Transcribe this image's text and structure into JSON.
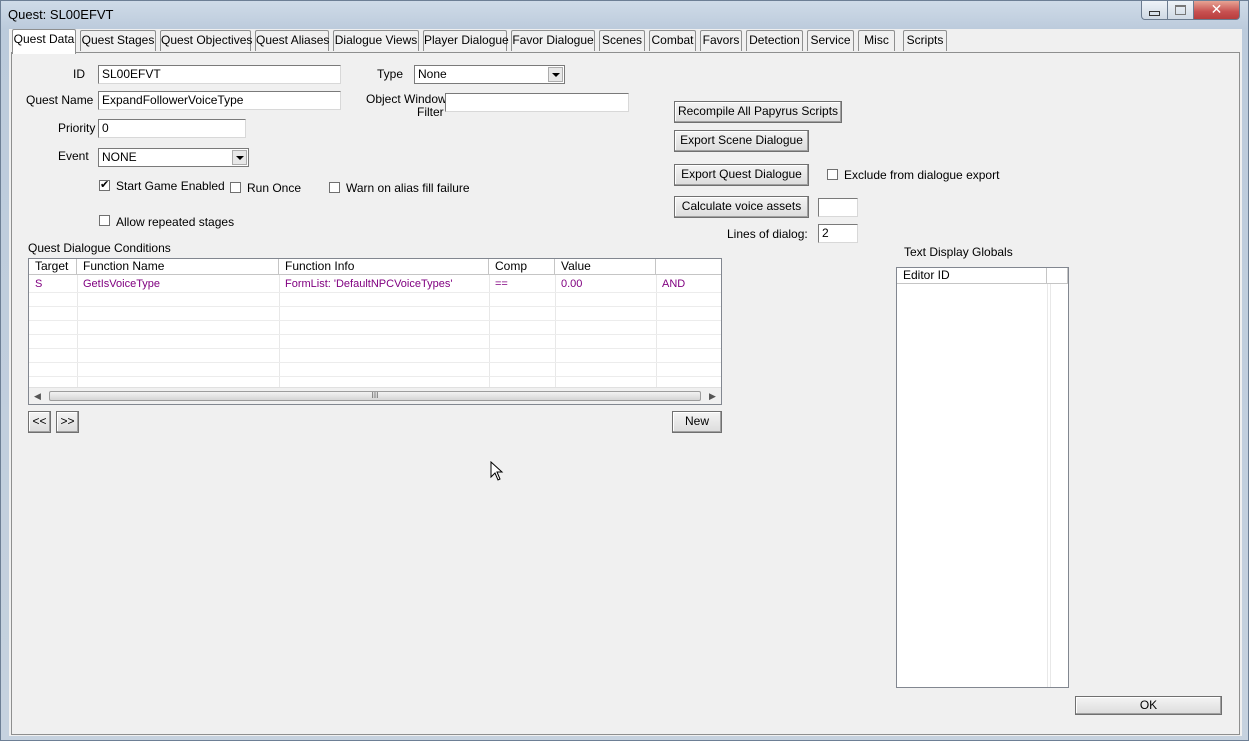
{
  "window": {
    "title": "Quest: SL00EFVT"
  },
  "tabs": [
    "Quest Data",
    "Quest Stages",
    "Quest Objectives",
    "Quest Aliases",
    "Dialogue Views",
    "Player Dialogue",
    "Favor Dialogue",
    "Scenes",
    "Combat",
    "Favors",
    "Detection",
    "Service",
    "Misc",
    "Scripts"
  ],
  "form": {
    "id_label": "ID",
    "id_value": "SL00EFVT",
    "name_label": "Quest Name",
    "name_value": "ExpandFollowerVoiceType",
    "priority_label": "Priority",
    "priority_value": "0",
    "event_label": "Event",
    "event_value": "NONE",
    "type_label": "Type",
    "type_value": "None",
    "filter_label_1": "Object Window",
    "filter_label_2": "Filter",
    "filter_value": "",
    "start_game_enabled": "Start Game Enabled",
    "start_game_enabled_checked": true,
    "run_once": "Run Once",
    "run_once_checked": false,
    "warn_alias": "Warn on alias fill failure",
    "warn_alias_checked": false,
    "allow_repeated": "Allow repeated stages",
    "allow_repeated_checked": false
  },
  "actions": {
    "recompile": "Recompile All Papyrus Scripts",
    "export_scene": "Export Scene Dialogue",
    "export_quest": "Export Quest Dialogue",
    "exclude_label": "Exclude from dialogue export",
    "exclude_checked": false,
    "calc_voice": "Calculate voice assets",
    "calc_voice_value": "",
    "lines_label": "Lines of dialog:",
    "lines_value": "2"
  },
  "conditions": {
    "title": "Quest Dialogue Conditions",
    "columns": [
      "Target",
      "Function Name",
      "Function Info",
      "Comp",
      "Value",
      ""
    ],
    "rows": [
      [
        "S",
        "GetIsVoiceType",
        "FormList: 'DefaultNPCVoiceTypes'",
        "==",
        "0.00",
        "AND"
      ]
    ],
    "prev_label": "<<",
    "next_label": ">>",
    "new_label": "New",
    "scroll_grip": "III"
  },
  "globals": {
    "title": "Text Display Globals",
    "columns": [
      "Editor ID"
    ],
    "rows": []
  },
  "ok_label": "OK",
  "icons": {
    "minimize": "minimize-icon",
    "maximize": "maximize-icon",
    "close": "close-icon",
    "check": "checkmark-icon",
    "dropdown": "chevron-down-icon",
    "cursor": "mouse-cursor-icon"
  }
}
